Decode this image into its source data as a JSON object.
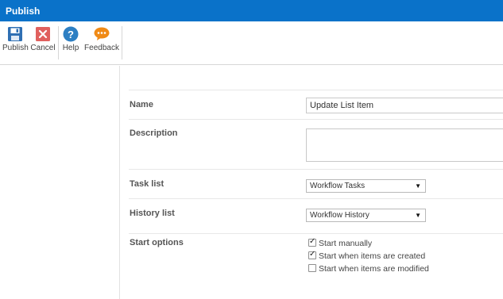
{
  "window": {
    "title": "Publish"
  },
  "ribbon": {
    "publish_label": "Publish",
    "cancel_label": "Cancel",
    "help_label": "Help",
    "feedback_label": "Feedback"
  },
  "form": {
    "name": {
      "label": "Name",
      "value": "Update List Item"
    },
    "description": {
      "label": "Description",
      "value": ""
    },
    "task_list": {
      "label": "Task list",
      "selected": "Workflow Tasks"
    },
    "history_list": {
      "label": "History list",
      "selected": "Workflow History"
    },
    "start_options": {
      "label": "Start options",
      "options": [
        {
          "label": "Start manually",
          "checked": true
        },
        {
          "label": "Start when items are created",
          "checked": true
        },
        {
          "label": "Start when items are modified",
          "checked": false
        }
      ]
    }
  },
  "colors": {
    "titlebar": "#0a72c9",
    "save_icon": "#2f6fb3",
    "cancel_icon": "#e0605e",
    "help_icon": "#2d7fc3",
    "feedback_icon": "#f08a16"
  },
  "icons": {
    "publish": "save-disk-icon",
    "cancel": "close-x-icon",
    "help": "question-mark-icon",
    "feedback": "speech-bubble-icon"
  }
}
